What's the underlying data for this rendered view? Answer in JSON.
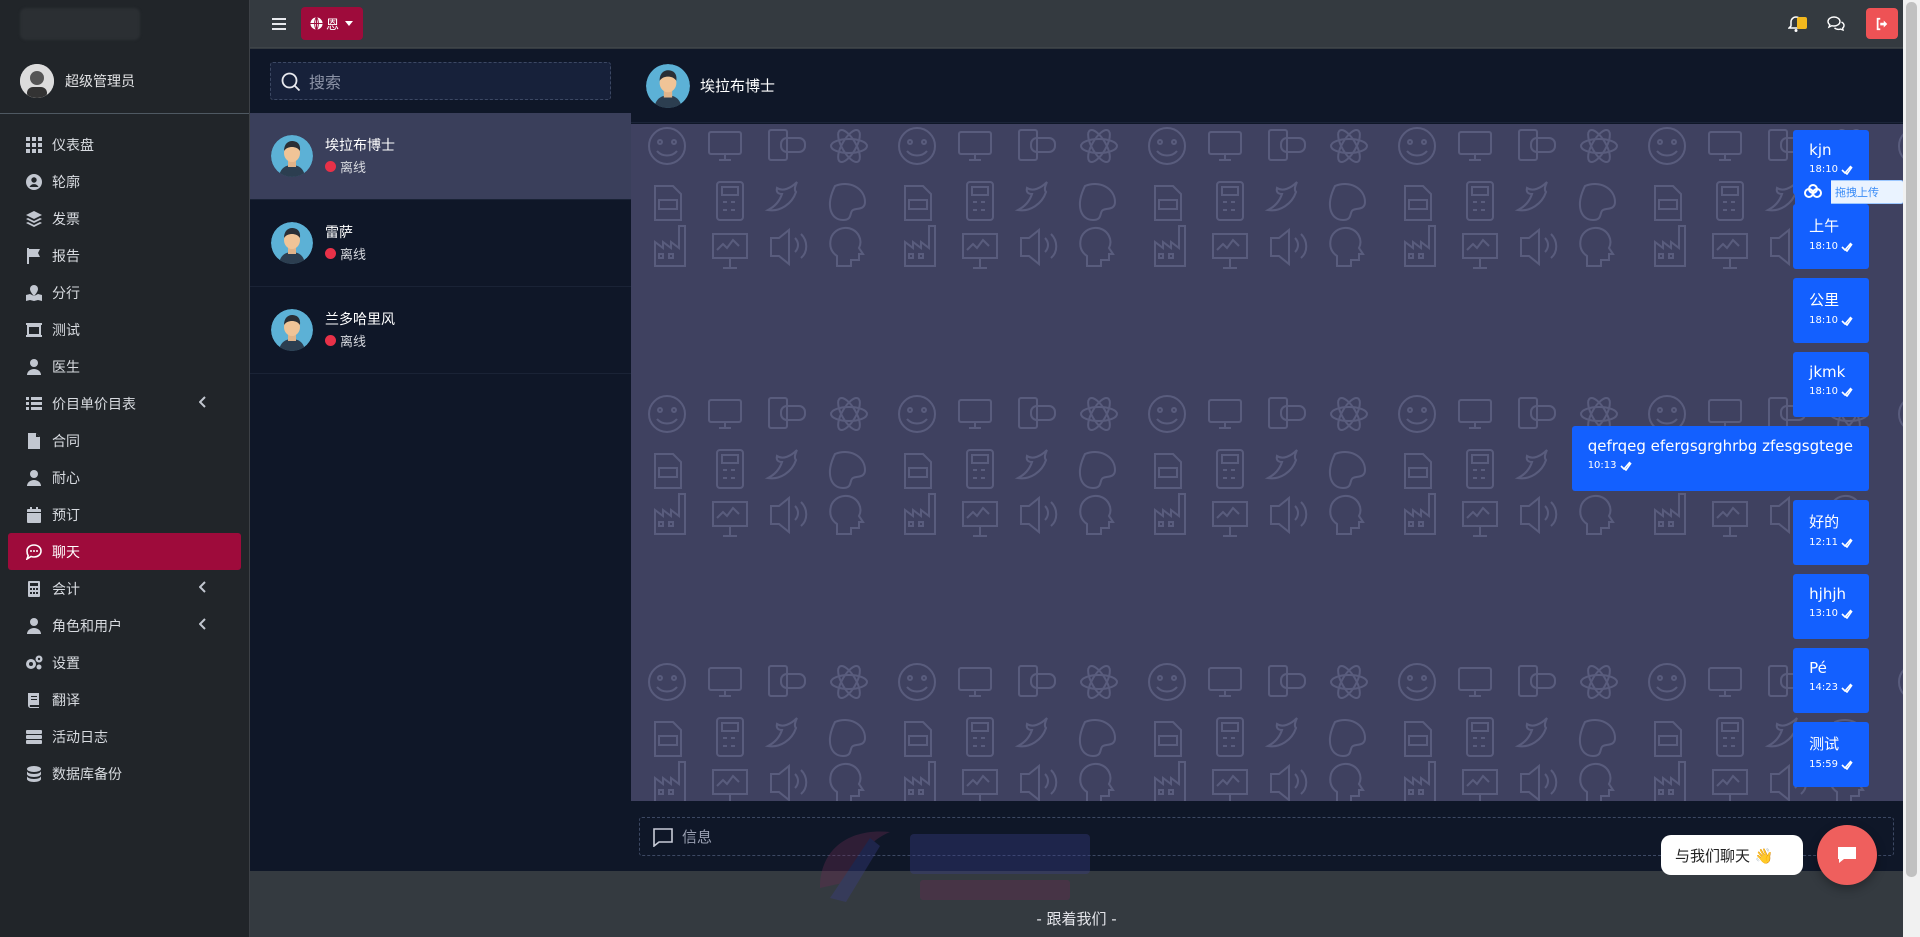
{
  "sidebar": {
    "user": {
      "name": "超级管理员"
    },
    "items": [
      {
        "label": "仪表盘",
        "icon": "grid-icon"
      },
      {
        "label": "轮廓",
        "icon": "user-circle-icon"
      },
      {
        "label": "发票",
        "icon": "layers-icon"
      },
      {
        "label": "报告",
        "icon": "flag-icon"
      },
      {
        "label": "分行",
        "icon": "map-marker-icon"
      },
      {
        "label": "测试",
        "icon": "test-icon"
      },
      {
        "label": "医生",
        "icon": "doctor-icon"
      },
      {
        "label": "价目单价目表",
        "icon": "list-icon",
        "has_submenu": true
      },
      {
        "label": "合同",
        "icon": "file-icon"
      },
      {
        "label": "耐心",
        "icon": "patient-icon"
      },
      {
        "label": "预订",
        "icon": "calendar-icon"
      },
      {
        "label": "聊天",
        "icon": "chat-icon",
        "active": true
      },
      {
        "label": "会计",
        "icon": "calculator-icon",
        "has_submenu": true
      },
      {
        "label": "角色和用户",
        "icon": "users-icon",
        "has_submenu": true
      },
      {
        "label": "设置",
        "icon": "cogs-icon"
      },
      {
        "label": "翻译",
        "icon": "book-icon"
      },
      {
        "label": "活动日志",
        "icon": "server-icon"
      },
      {
        "label": "数据库备份",
        "icon": "database-icon"
      }
    ]
  },
  "topbar": {
    "language": "恩",
    "notification_badge": ""
  },
  "contacts": {
    "search_placeholder": "搜索",
    "list": [
      {
        "name": "埃拉布博士",
        "status": "离线"
      },
      {
        "name": "雷萨",
        "status": "离线"
      },
      {
        "name": "兰多哈里风",
        "status": "离线"
      }
    ]
  },
  "chat": {
    "current_contact": "埃拉布博士",
    "input_placeholder": "信息",
    "messages": [
      {
        "text": "kjn",
        "time": "18:10"
      },
      {
        "text": "上午",
        "time": "18:10"
      },
      {
        "text": "公里",
        "time": "18:10"
      },
      {
        "text": "jkmk",
        "time": "18:10"
      },
      {
        "text": "qefrqeg efergsgrghrbg zfesgsgtege",
        "time": "10:13"
      },
      {
        "text": "好的",
        "time": "12:11"
      },
      {
        "text": "hjhjh",
        "time": "13:10"
      },
      {
        "text": "Pé",
        "time": "14:23"
      },
      {
        "text": "测试",
        "time": "15:59"
      }
    ],
    "drag_upload_label": "拖拽上传"
  },
  "footer": {
    "follow": "- 跟着我们 -"
  },
  "livechat": {
    "tip": "与我们聊天 👋"
  },
  "colors": {
    "accent": "#9e0b3b",
    "bubble": "#1360ff",
    "offline": "#e83148",
    "chat_bg": "#3f4160",
    "panel_bg": "#0f1728",
    "sidebar_bg": "#212529"
  }
}
